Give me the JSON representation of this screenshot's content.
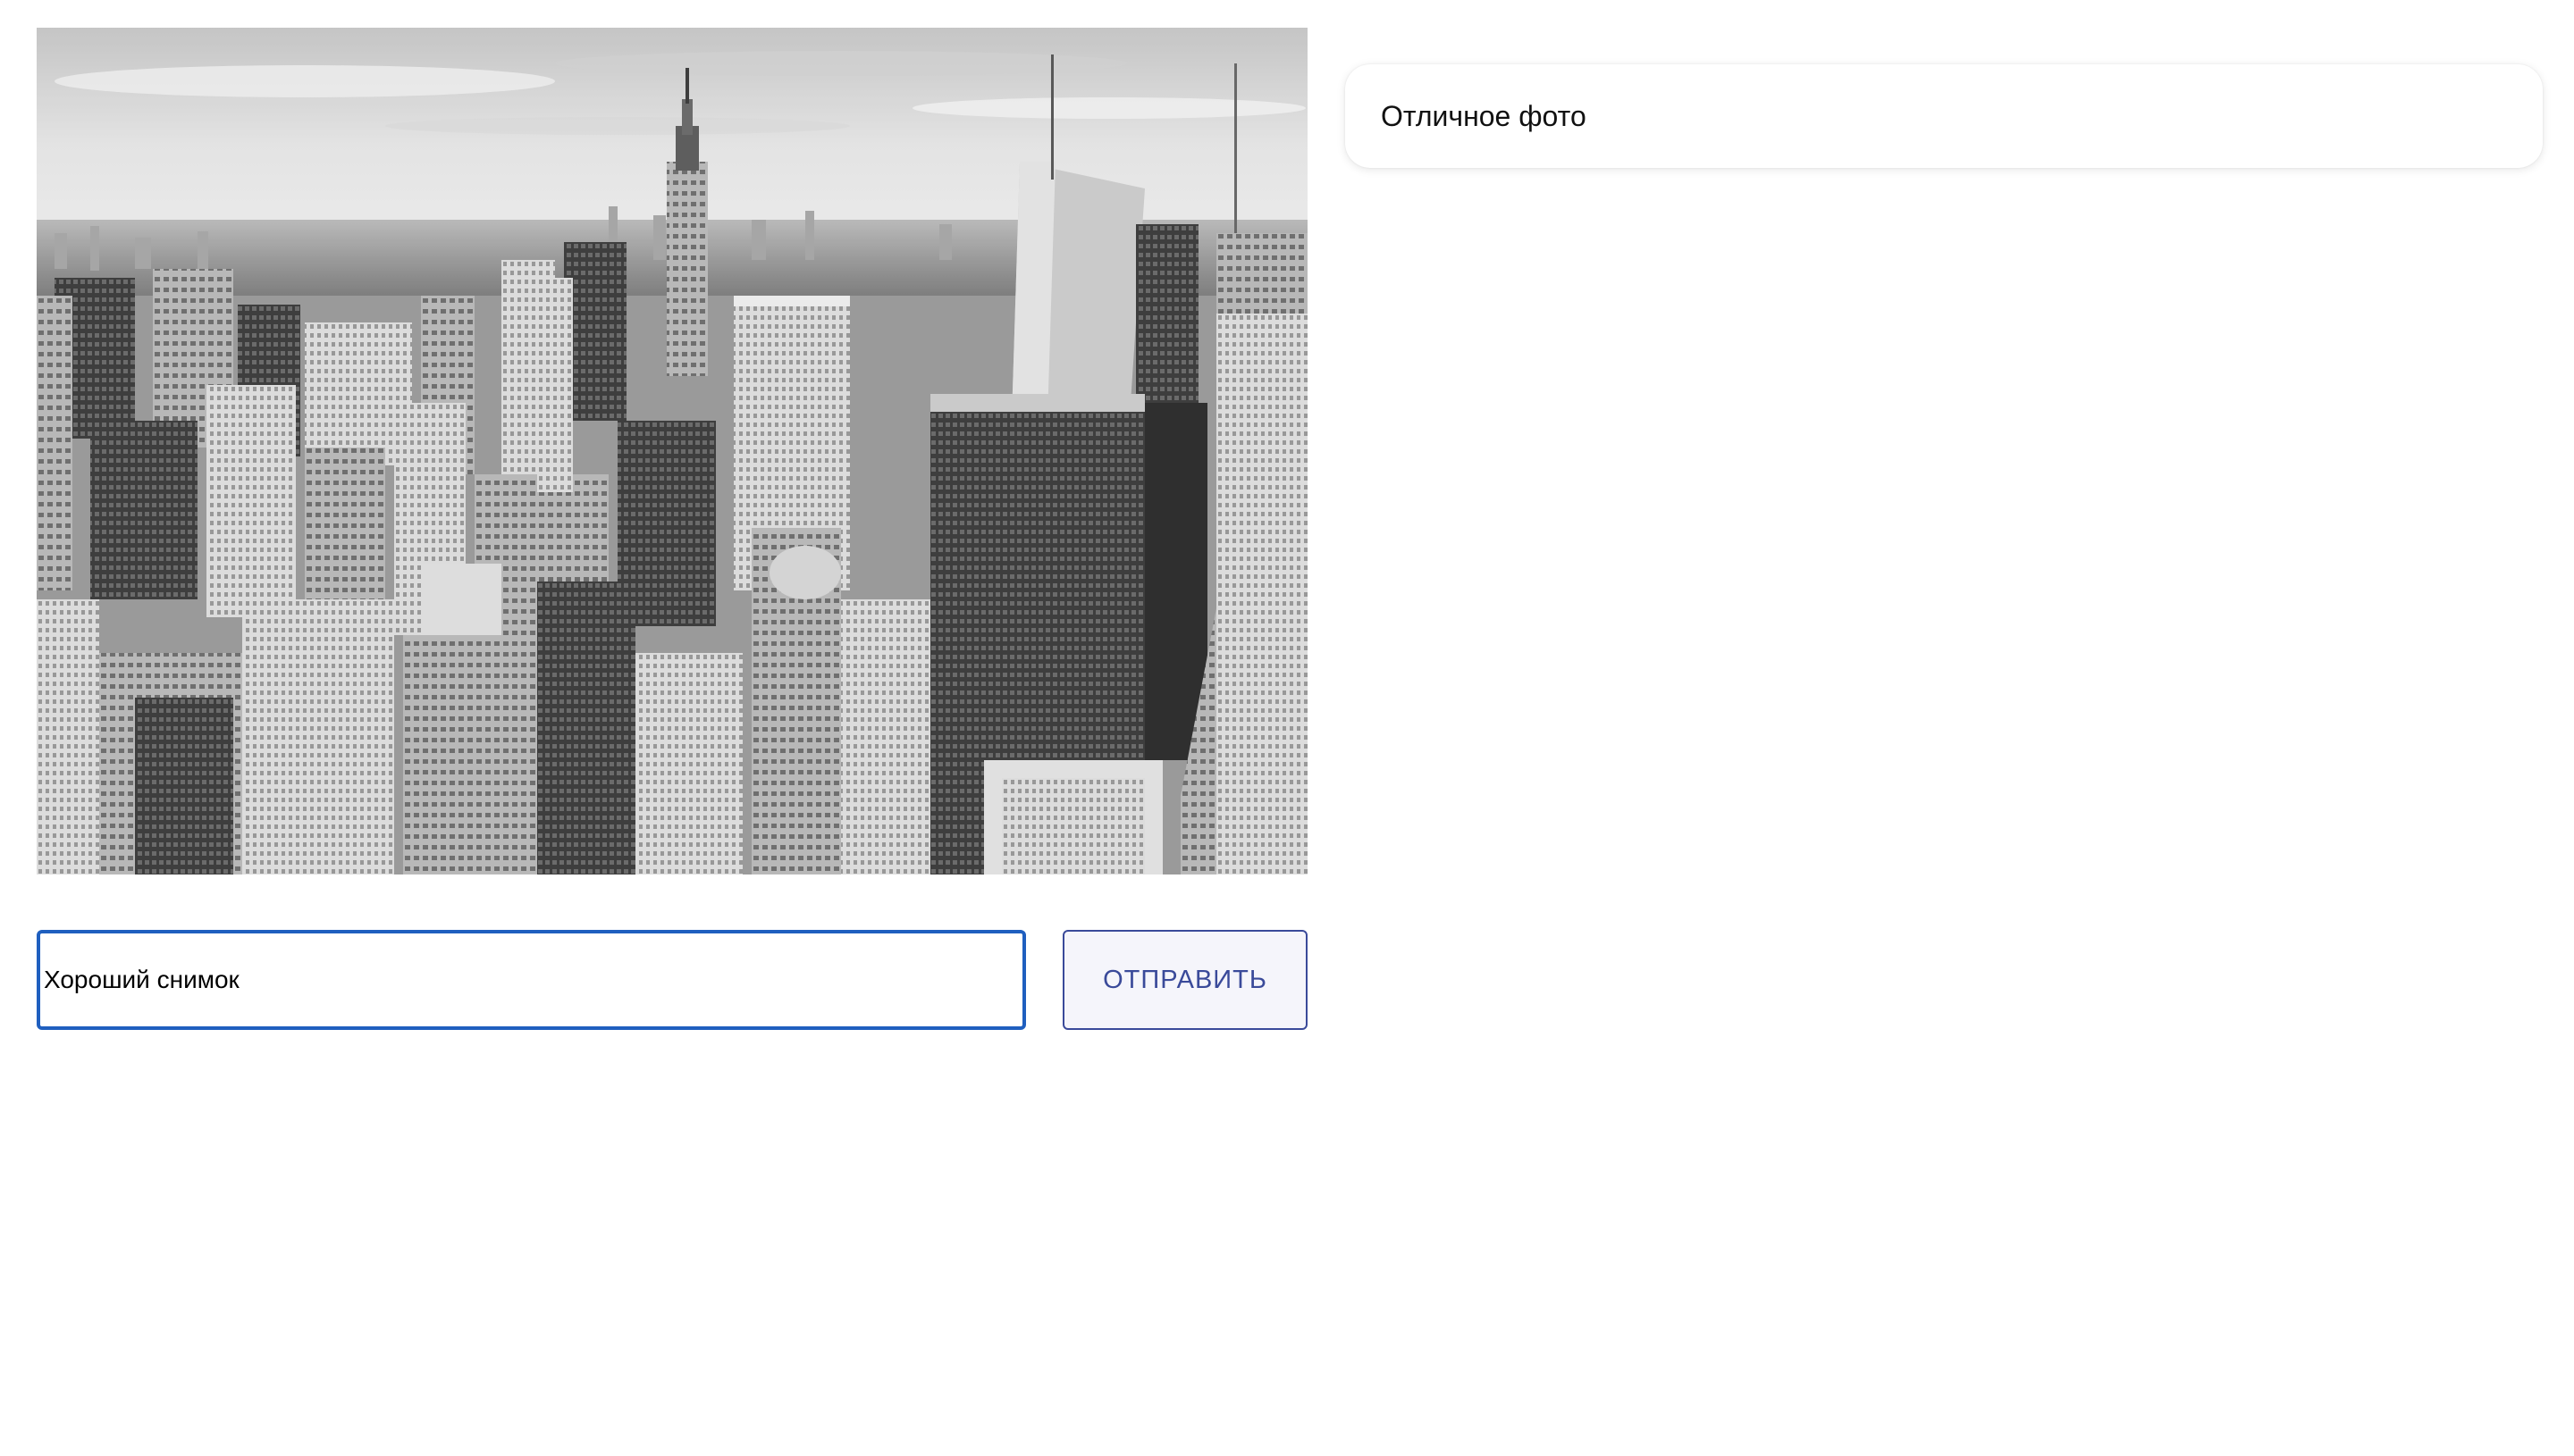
{
  "photo": {
    "subject": "black-and-white aerial city skyline",
    "tones": {
      "sky": "#e6e6e6",
      "buildings_dark": "#2b2b2b",
      "buildings_light": "#d8d8d8"
    }
  },
  "comment_form": {
    "input_value": "Хороший снимок",
    "send_label": "ОТПРАВИТЬ"
  },
  "comments": [
    {
      "text": "Отличное фото"
    }
  ],
  "colors": {
    "input_border": "#1f5fbf",
    "button_text": "#3a4a9a",
    "button_bg": "#f5f5fb"
  }
}
